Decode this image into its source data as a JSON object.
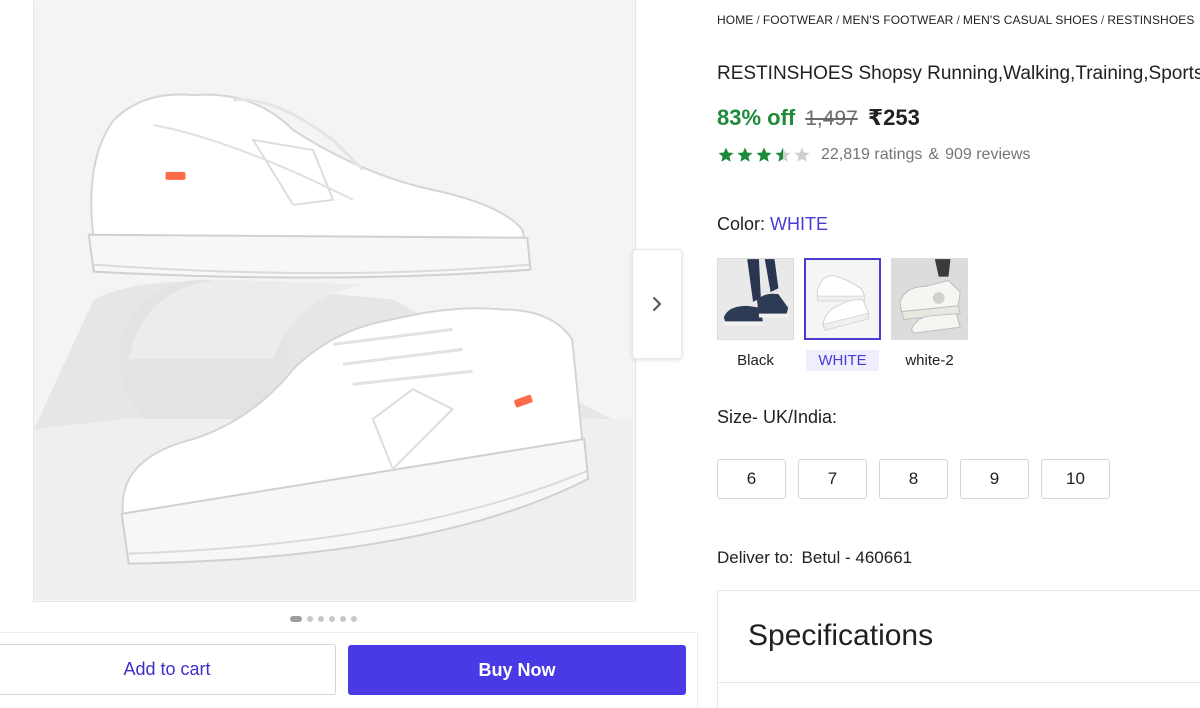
{
  "breadcrumb": [
    "HOME",
    "FOOTWEAR",
    "MEN'S FOOTWEAR",
    "MEN'S CASUAL SHOES",
    "RESTINSHOES"
  ],
  "product": {
    "title": "RESTINSHOES Shopsy Running,Walking,Training,Sports Shoes",
    "discount": "83% off",
    "mrp": "1,497",
    "price": "₹253",
    "rating_value": 3.5,
    "ratings": "22,819 ratings",
    "amp": "&",
    "reviews": "909 reviews"
  },
  "color": {
    "label": "Color:",
    "selected": "WHITE",
    "options": [
      {
        "name": "Black"
      },
      {
        "name": "WHITE"
      },
      {
        "name": "white-2"
      }
    ]
  },
  "size": {
    "label": "Size- UK/India:",
    "options": [
      "6",
      "7",
      "8",
      "9",
      "10"
    ]
  },
  "delivery": {
    "label": "Deliver to:",
    "location": "Betul - 460661"
  },
  "specifications": {
    "title": "Specifications"
  },
  "gallery": {
    "image_count": 6,
    "active_index": 0
  },
  "actions": {
    "add_to_cart": "Add to cart",
    "buy_now": "Buy Now"
  },
  "colors": {
    "accent": "#4a3ae6",
    "discount_green": "#1e8a3a",
    "star_green": "#1e8a3a"
  },
  "icons": {
    "next": "chevron-right-icon",
    "star": "star-icon"
  }
}
